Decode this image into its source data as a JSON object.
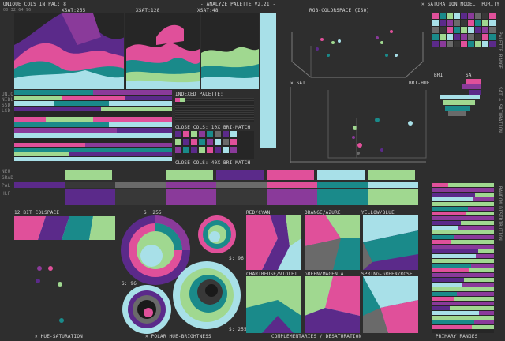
{
  "header": {
    "unique_cols": "UNIQUE COLS IN PAL: 8",
    "xsat_left": "XSAT:255",
    "xsat_mid": "XSAT:128",
    "xsat_right": "XSAT:48",
    "app_title": "- ANALYZE PALETTE V2.21 -",
    "colorspace": "RGB-COLORSPACE (ISO)",
    "sat_model": "× SATURATION MODEL: PURITY"
  },
  "tiny_ticks": "00 32 64 96",
  "left_labels": [
    "UNIQ",
    "NIBL",
    "SSD",
    "LSD"
  ],
  "indexed_palette_label": "INDEXED PALETTE:",
  "close_cols_1": "CLOSE COLS: 10X BRI-MATCH",
  "close_cols_2": "CLOSE COLS: 40X BRI-MATCH",
  "sat_label": "× SAT",
  "bri_hue_label": "BRI-HUE",
  "bri_label": "BRI",
  "sat_label_2": "SAT",
  "right_vertical_1": "PALETTE RANGE",
  "right_vertical_2": "SAT & SATURATION",
  "right_vertical_3": "RANDOM DISTRIBUTION",
  "mid_labels": [
    "NEU",
    "GRAD",
    "PAL",
    "HLF"
  ],
  "colspace_label": "12 BIT COLSPACE",
  "s255_a": "S: 255",
  "s96_a": "S: 96",
  "s96_b": "S: 96",
  "s255_b": "S: 255",
  "pairs": [
    "RED/CYAN",
    "ORANGE/AZURE",
    "YELLOW/BLUE",
    "CHARTREUSE/VIOLET",
    "GREEN/MAGENTA",
    "SPRING-GREEN/ROSE"
  ],
  "footer": {
    "hue_sat": "× HUE-SATURATION",
    "polar": "× POLAR HUE-BRIGHTNESS",
    "complementaries": "COMPLEMENTARIES / DESATURATION",
    "primary": "PRIMARY RANGES"
  },
  "palette": {
    "black": "#1a1a1a",
    "dark": "#383838",
    "grey": "#6a6a6a",
    "violet": "#5b2a8a",
    "purple": "#8a3a9a",
    "pink": "#e0509a",
    "teal": "#1a8a8a",
    "green": "#a0d890",
    "cyan": "#a8e0e8"
  }
}
